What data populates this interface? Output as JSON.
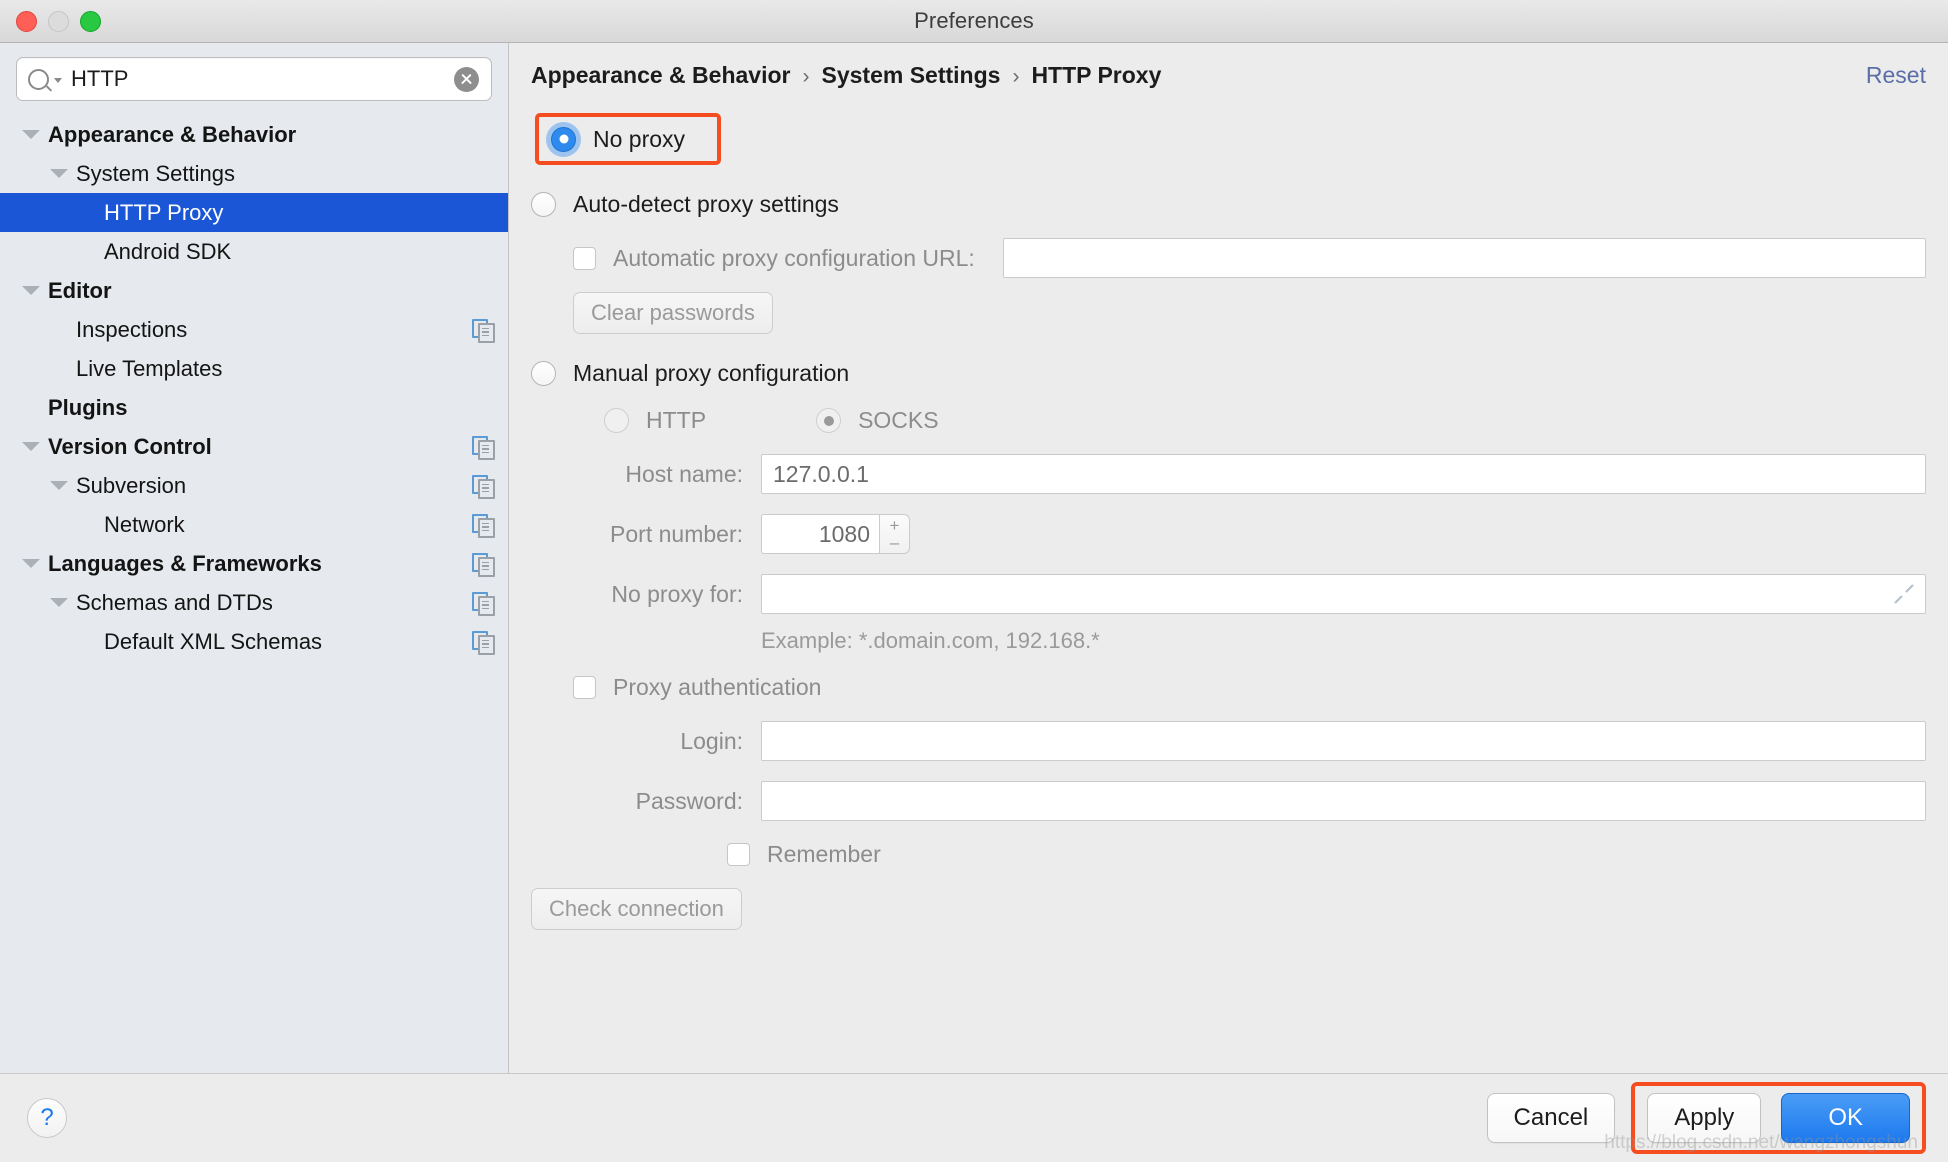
{
  "window": {
    "title": "Preferences",
    "traffic_lights": [
      "close-button",
      "minimize-button",
      "zoom-button"
    ]
  },
  "search": {
    "value": "HTTP",
    "placeholder": "",
    "icon": "search-icon",
    "clear_icon": "clear-icon"
  },
  "sidebar": {
    "items": [
      {
        "label": "Appearance & Behavior",
        "level": 0,
        "bold": true,
        "twisty": "down",
        "selected": false,
        "badge": false
      },
      {
        "label": "System Settings",
        "level": 1,
        "bold": false,
        "twisty": "down",
        "selected": false,
        "badge": false
      },
      {
        "label": "HTTP Proxy",
        "level": 2,
        "bold": false,
        "twisty": "none",
        "selected": true,
        "badge": false
      },
      {
        "label": "Android SDK",
        "level": 2,
        "bold": false,
        "twisty": "none",
        "selected": false,
        "badge": false
      },
      {
        "label": "Editor",
        "level": 0,
        "bold": true,
        "twisty": "down",
        "selected": false,
        "badge": false
      },
      {
        "label": "Inspections",
        "level": 1,
        "bold": false,
        "twisty": "none",
        "selected": false,
        "badge": true
      },
      {
        "label": "Live Templates",
        "level": 1,
        "bold": false,
        "twisty": "none",
        "selected": false,
        "badge": false
      },
      {
        "label": "Plugins",
        "level": 0,
        "bold": true,
        "twisty": "none",
        "selected": false,
        "badge": false
      },
      {
        "label": "Version Control",
        "level": 0,
        "bold": true,
        "twisty": "down",
        "selected": false,
        "badge": true
      },
      {
        "label": "Subversion",
        "level": 1,
        "bold": false,
        "twisty": "down",
        "selected": false,
        "badge": true
      },
      {
        "label": "Network",
        "level": 2,
        "bold": false,
        "twisty": "none",
        "selected": false,
        "badge": true
      },
      {
        "label": "Languages & Frameworks",
        "level": 0,
        "bold": true,
        "twisty": "down",
        "selected": false,
        "badge": true
      },
      {
        "label": "Schemas and DTDs",
        "level": 1,
        "bold": false,
        "twisty": "down",
        "selected": false,
        "badge": true
      },
      {
        "label": "Default XML Schemas",
        "level": 2,
        "bold": false,
        "twisty": "none",
        "selected": false,
        "badge": true
      }
    ]
  },
  "breadcrumb": {
    "parts": [
      "Appearance & Behavior",
      "System Settings",
      "HTTP Proxy"
    ],
    "separator": "›",
    "reset_label": "Reset"
  },
  "proxy": {
    "no_proxy_label": "No proxy",
    "no_proxy_selected": true,
    "auto_detect_label": "Auto-detect proxy settings",
    "auto_detect_selected": false,
    "auto_config_url_label": "Automatic proxy configuration URL:",
    "auto_config_url_checked": false,
    "auto_config_url_value": "",
    "clear_passwords_label": "Clear passwords",
    "manual_label": "Manual proxy configuration",
    "manual_selected": false,
    "http_label": "HTTP",
    "http_selected": false,
    "socks_label": "SOCKS",
    "socks_selected": true,
    "host_name_label": "Host name:",
    "host_name_value": "127.0.0.1",
    "port_label": "Port number:",
    "port_value": "1080",
    "stepper_up": "+",
    "stepper_down": "–",
    "no_proxy_for_label": "No proxy for:",
    "no_proxy_for_value": "",
    "expand_icon": "expand-icon",
    "example_hint": "Example: *.domain.com, 192.168.*",
    "proxy_auth_label": "Proxy authentication",
    "proxy_auth_checked": false,
    "login_label": "Login:",
    "login_value": "",
    "password_label": "Password:",
    "password_value": "",
    "remember_label": "Remember",
    "remember_checked": false,
    "check_connection_label": "Check connection"
  },
  "footer": {
    "help_glyph": "?",
    "cancel_label": "Cancel",
    "apply_label": "Apply",
    "ok_label": "OK",
    "watermark": "https://blog.csdn.net/wangzhongshun"
  },
  "colors": {
    "annotation": "#f54d20",
    "selection": "#1a56d6",
    "primary_button": "#1d79ef",
    "sidebar_bg": "#e6eaee",
    "content_bg": "#ececec"
  }
}
